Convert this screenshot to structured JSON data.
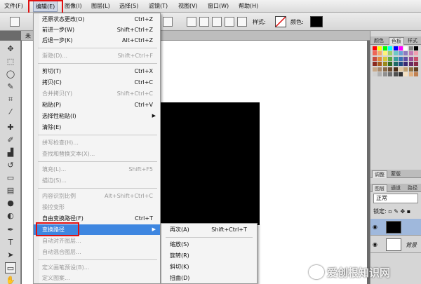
{
  "menubar": {
    "items": [
      "文件(F)",
      "编辑(E)",
      "图像(I)",
      "图层(L)",
      "选择(S)",
      "滤镜(T)",
      "视图(V)",
      "窗口(W)",
      "帮助(H)"
    ]
  },
  "options_bar": {
    "style_label": "样式:",
    "color_label": "颜色:"
  },
  "doc_tab": "未",
  "edit_menu": {
    "items": [
      {
        "label": "还原状态更改(O)",
        "shortcut": "Ctrl+Z",
        "disabled": false
      },
      {
        "label": "前进一步(W)",
        "shortcut": "Shift+Ctrl+Z",
        "disabled": false
      },
      {
        "label": "后退一步(K)",
        "shortcut": "Alt+Ctrl+Z",
        "disabled": false
      },
      {
        "label": "渐隐(D)...",
        "shortcut": "Shift+Ctrl+F",
        "disabled": true
      },
      {
        "label": "剪切(T)",
        "shortcut": "Ctrl+X",
        "disabled": false
      },
      {
        "label": "拷贝(C)",
        "shortcut": "Ctrl+C",
        "disabled": false
      },
      {
        "label": "合并拷贝(Y)",
        "shortcut": "Shift+Ctrl+C",
        "disabled": true
      },
      {
        "label": "粘贴(P)",
        "shortcut": "Ctrl+V",
        "disabled": false
      },
      {
        "label": "选择性粘贴(I)",
        "shortcut": "",
        "disabled": false,
        "submenu": true
      },
      {
        "label": "清除(E)",
        "shortcut": "",
        "disabled": false
      },
      {
        "label": "拼写检查(H)...",
        "shortcut": "",
        "disabled": true
      },
      {
        "label": "查找和替换文本(X)...",
        "shortcut": "",
        "disabled": true
      },
      {
        "label": "填充(L)...",
        "shortcut": "Shift+F5",
        "disabled": true
      },
      {
        "label": "描边(S)...",
        "shortcut": "",
        "disabled": true
      },
      {
        "label": "内容识别比例",
        "shortcut": "Alt+Shift+Ctrl+C",
        "disabled": true
      },
      {
        "label": "操控变形",
        "shortcut": "",
        "disabled": true
      },
      {
        "label": "自由变换路径(F)",
        "shortcut": "Ctrl+T",
        "disabled": false
      },
      {
        "label": "变换路径",
        "shortcut": "",
        "disabled": false,
        "submenu": true,
        "highlighted": true
      },
      {
        "label": "自动对齐图层...",
        "shortcut": "",
        "disabled": true
      },
      {
        "label": "自动混合图层...",
        "shortcut": "",
        "disabled": true
      },
      {
        "label": "定义画笔预设(B)...",
        "shortcut": "",
        "disabled": true
      },
      {
        "label": "定义图案...",
        "shortcut": "",
        "disabled": true
      }
    ]
  },
  "transform_submenu": {
    "items": [
      {
        "label": "再次(A)",
        "shortcut": "Shift+Ctrl+T"
      },
      {
        "label": "缩放(S)",
        "shortcut": ""
      },
      {
        "label": "旋转(R)",
        "shortcut": ""
      },
      {
        "label": "斜切(K)",
        "shortcut": ""
      },
      {
        "label": "扭曲(D)",
        "shortcut": ""
      }
    ]
  },
  "panels": {
    "top_tabs": [
      "颜色",
      "色板",
      "样式"
    ],
    "mid_tabs": [
      "调整",
      "蒙版"
    ],
    "layer_tabs": [
      "图层",
      "通道",
      "路径"
    ],
    "blend_mode": "正常",
    "lock_label": "锁定:",
    "background_layer": "背景"
  },
  "watermark": "爱创根知识网",
  "colors": {
    "highlight": "#3e86e0",
    "annotation": "#e01010"
  }
}
